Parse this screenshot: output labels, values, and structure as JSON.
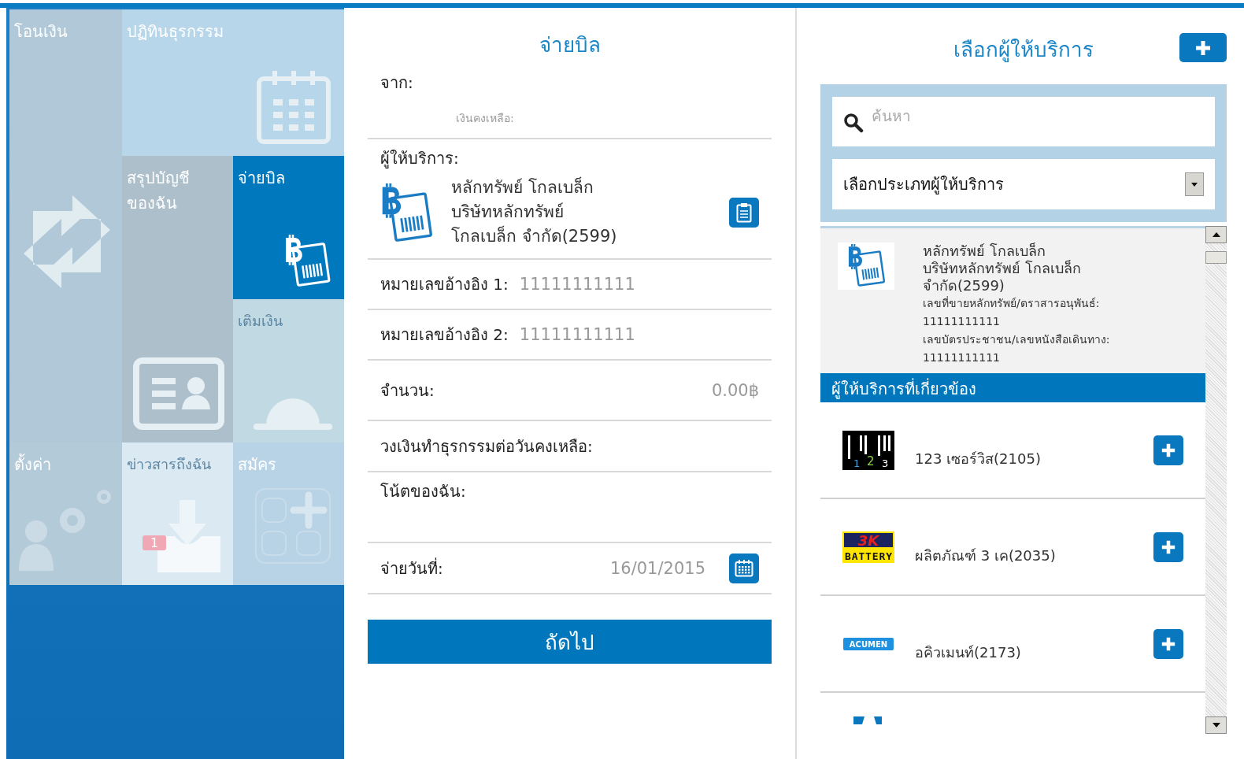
{
  "sidebar": {
    "tiles": [
      {
        "label": "โอนเงิน",
        "kind": "transfer",
        "selected": false
      },
      {
        "label": "ปฏิทินธุรกรรม",
        "kind": "calendar",
        "selected": false
      },
      {
        "label": "สรุปบัญชีของฉัน",
        "kind": "account",
        "selected": false
      },
      {
        "label": "จ่ายบิล",
        "kind": "bill",
        "selected": true
      },
      {
        "label": "เติมเงิน",
        "kind": "topup",
        "selected": false
      },
      {
        "label": "ตั้งค่า",
        "kind": "settings",
        "selected": false
      },
      {
        "label": "ข่าวสารถึงฉัน",
        "kind": "inbox",
        "selected": false,
        "badge": "1"
      },
      {
        "label": "สมัคร",
        "kind": "register",
        "selected": false
      }
    ]
  },
  "bill_form": {
    "title": "จ่ายบิล",
    "from_label": "จาก:",
    "balance_label": "เงินคงเหลือ:",
    "provider_label": "ผู้ให้บริการ:",
    "provider_name_lines": [
      "หลักทรัพย์ โกลเบล็ก",
      "บริษัทหลักทรัพย์",
      "โกลเบล็ก จำกัด(2599)"
    ],
    "fields": [
      {
        "kind": "inline",
        "label": "หมายเลขอ้างอิง 1:",
        "value": "11111111111"
      },
      {
        "kind": "inline",
        "label": "หมายเลขอ้างอิง 2:",
        "value": "11111111111"
      },
      {
        "kind": "amount",
        "label": "จำนวน:",
        "value": "0.00฿"
      },
      {
        "kind": "plain",
        "label": "วงเงินทำธุรกรรมต่อวันคงเหลือ:"
      },
      {
        "kind": "note",
        "label": "โน้ตของฉัน:"
      },
      {
        "kind": "date",
        "label": "จ่ายวันที่:",
        "value": "16/01/2015"
      }
    ],
    "next_button": "ถัดไป"
  },
  "provider_picker": {
    "title": "เลือกผู้ให้บริการ",
    "search": {
      "placeholder": "ค้นหา"
    },
    "type_select": {
      "value": "เลือกประเภทผู้ให้บริการ"
    },
    "selected_provider": {
      "name_lines": [
        "หลักทรัพย์ โกลเบล็ก",
        "บริษัทหลักทรัพย์ โกลเบล็ก",
        "จำกัด(2599)"
      ],
      "details": [
        "เลขที่ขายหลักทรัพย์/ตราสารอนุพันธ์:",
        "11111111111",
        "เลขบัตรประชาชน/เลขหนังสือเดินทาง:",
        "11111111111"
      ]
    },
    "related_header": "ผู้ให้บริการที่เกี่ยวข้อง",
    "related": [
      {
        "name": "123 เซอร์วิส(2105)",
        "kind": "barcode",
        "logo_text": [
          "1",
          "2",
          "3"
        ]
      },
      {
        "name": "ผลิตภัณฑ์ 3 เค(2035)",
        "kind": "battery",
        "logo_text": [
          "3K",
          "BATTERY"
        ]
      },
      {
        "name": "อคิวเมนท์(2173)",
        "kind": "acumen",
        "logo_text": [
          "ACUMEN"
        ]
      },
      {
        "kind": "partial"
      }
    ]
  }
}
